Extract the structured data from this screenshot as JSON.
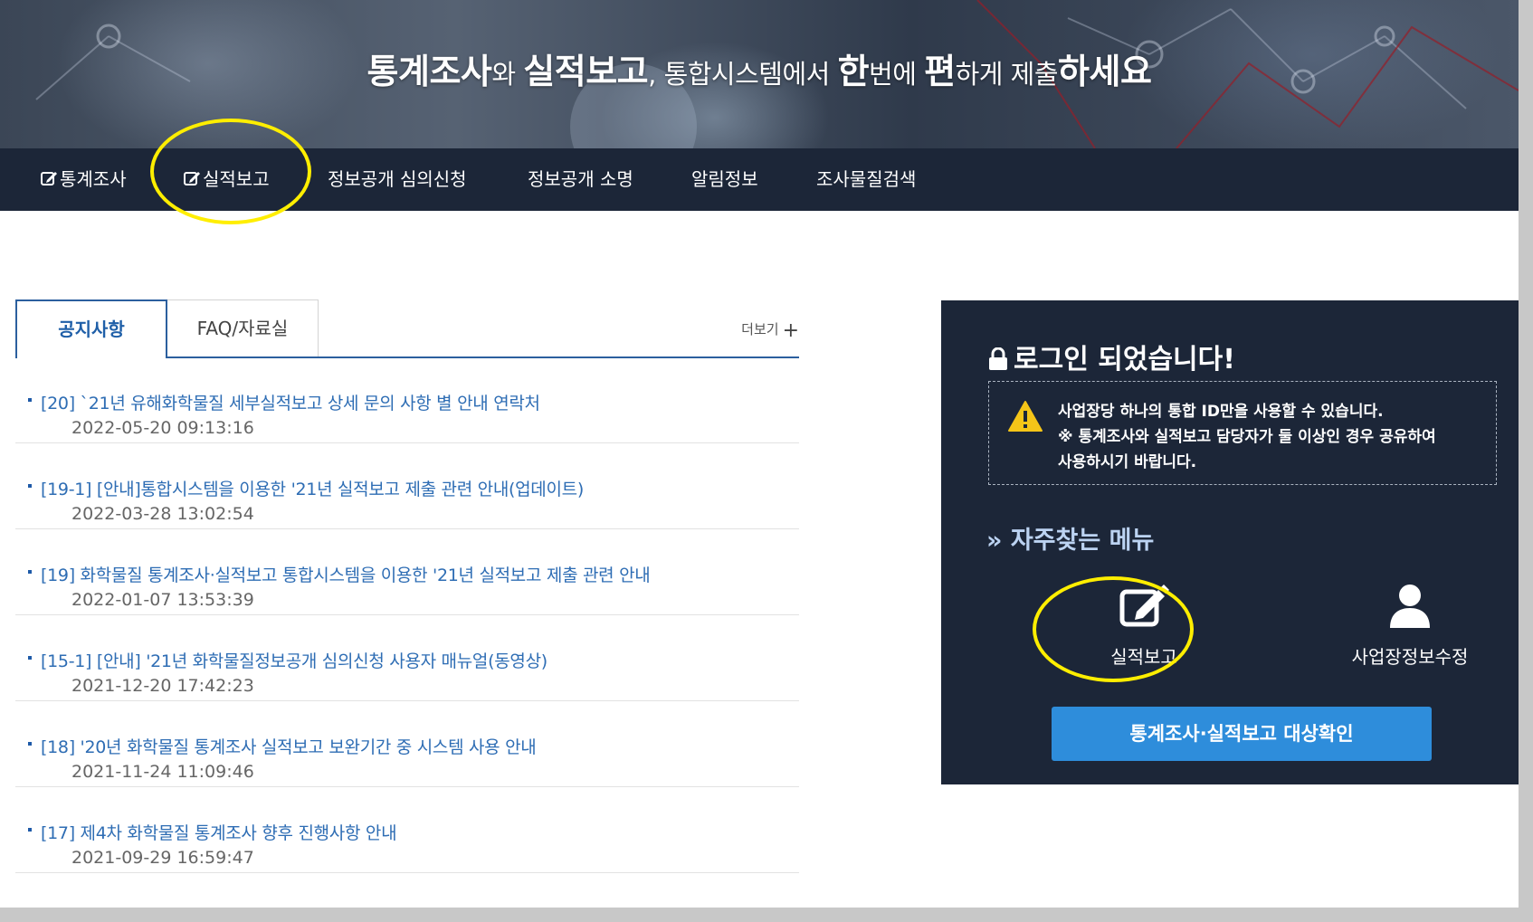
{
  "banner": {
    "part1": "통계조사",
    "part2": "와 ",
    "part3": "실적보고",
    "part4": ", 통합시스템에서 ",
    "part5": "한",
    "part6": "번에 ",
    "part7": "편",
    "part8": "하게 제출",
    "part9": "하세요"
  },
  "nav": {
    "items": [
      {
        "label": "통계조사",
        "icon": "edit-icon"
      },
      {
        "label": "실적보고",
        "icon": "edit-icon"
      },
      {
        "label": "정보공개 심의신청"
      },
      {
        "label": "정보공개 소명"
      },
      {
        "label": "알림정보"
      },
      {
        "label": "조사물질검색"
      }
    ]
  },
  "board": {
    "tabs": [
      "공지사항",
      "FAQ/자료실"
    ],
    "more": "더보기",
    "posts": [
      {
        "title": "[20] `21년 유해화학물질 세부실적보고 상세 문의 사항 별 안내 연락처",
        "date": "2022-05-20 09:13:16"
      },
      {
        "title": "[19-1] [안내]통합시스템을 이용한 '21년 실적보고 제출 관련 안내(업데이트)",
        "date": "2022-03-28 13:02:54"
      },
      {
        "title": "[19] 화학물질 통계조사·실적보고 통합시스템을 이용한 '21년 실적보고 제출 관련 안내",
        "date": "2022-01-07 13:53:39"
      },
      {
        "title": "[15-1] [안내] '21년 화학물질정보공개 심의신청 사용자 매뉴얼(동영상)",
        "date": "2021-12-20 17:42:23"
      },
      {
        "title": "[18] '20년 화학물질 통계조사 실적보고 보완기간 중 시스템 사용 안내",
        "date": "2021-11-24 11:09:46"
      },
      {
        "title": "[17] 제4차 화학물질 통계조사 향후 진행사항 안내",
        "date": "2021-09-29 16:59:47"
      }
    ]
  },
  "panel": {
    "title": "로그인 되었습니다!",
    "notice_l1": "사업장당 하나의 통합 ID만을 사용할 수 있습니다.",
    "notice_l2": "※ 통계조사와 실적보고 담당자가 둘 이상인 경우 공유하여",
    "notice_l3": "사용하시기 바랍니다.",
    "fav_title": "» 자주찾는 메뉴",
    "fav_items": [
      {
        "label": "실적보고",
        "icon": "edit-icon"
      },
      {
        "label": "사업장정보수정",
        "icon": "user-icon"
      }
    ],
    "cta": "통계조사·실적보고 대상확인"
  },
  "colors": {
    "nav_bg": "#1c2638",
    "panel_bg": "#1c2638",
    "accent_blue": "#2e8ddb",
    "link_blue": "#2e6db4",
    "highlight": "#ffee00"
  }
}
